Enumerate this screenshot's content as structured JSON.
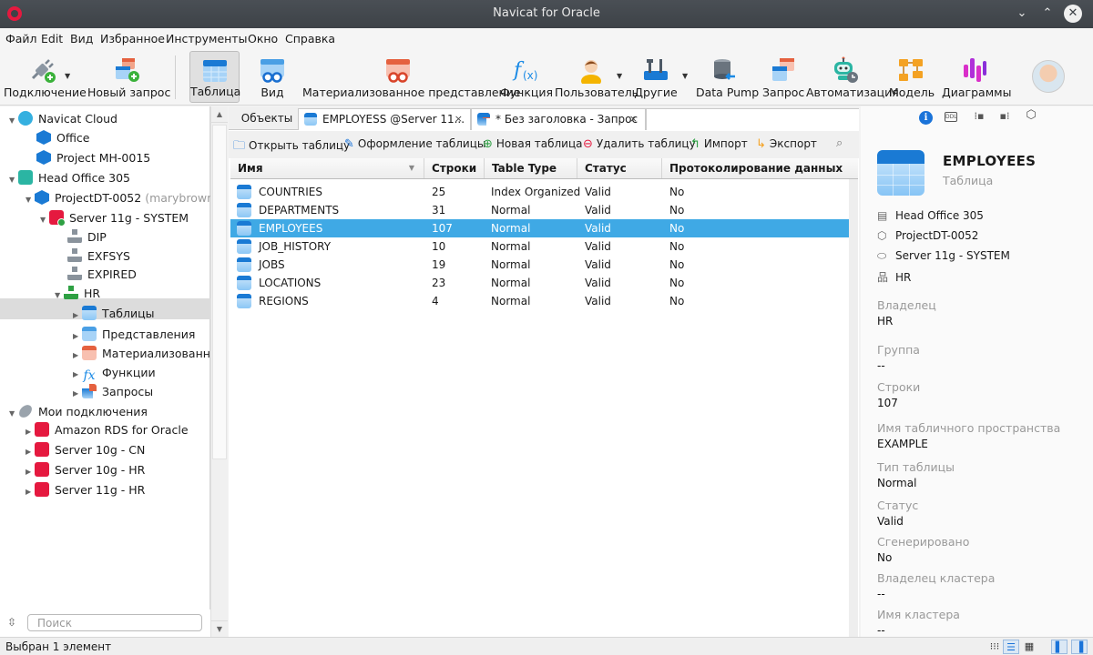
{
  "window": {
    "title": "Navicat for Oracle",
    "minimize": "⌄",
    "maximize": "⌃",
    "close": "✕"
  },
  "menu": [
    "Файл",
    "Edit",
    "Вид",
    "Избранное",
    "Инструменты",
    "Окно",
    "Справка"
  ],
  "toolbar": {
    "connection": "Подключение",
    "new_query": "Новый запрос",
    "table": "Таблица",
    "view": "Вид",
    "mat_view": "Материализованное представление",
    "function": "Функция",
    "user": "Пользователь",
    "other": "Другие",
    "data_pump": "Data Pump",
    "query": "Запрос",
    "automation": "Автоматизация",
    "model": "Модель",
    "charts": "Диаграммы"
  },
  "tree": {
    "navicat_cloud": "Navicat Cloud",
    "office": "Office",
    "project_mh": "Project MH-0015",
    "head_office": "Head Office 305",
    "project_dt": "ProjectDT-0052",
    "project_dt_user": "(marybrown@",
    "server_11g_system": "Server 11g - SYSTEM",
    "dip": "DIP",
    "exfsys": "EXFSYS",
    "expired": "EXPIRED",
    "hr": "HR",
    "tables": "Таблицы",
    "views": "Представления",
    "mat_views": "Материализованны",
    "functions": "Функции",
    "queries": "Запросы",
    "my_connections": "Мои подключения",
    "amazon_rds": "Amazon RDS for Oracle",
    "server_10g_cn": "Server 10g - CN",
    "server_10g_hr": "Server 10g - HR",
    "server_11g_hr": "Server 11g - HR"
  },
  "search": {
    "placeholder": "Поиск"
  },
  "status": {
    "text": "Выбран 1 элемент"
  },
  "tabs": {
    "objects": "Объекты",
    "tab1": "EMPLOYESS @Server 11...",
    "tab2": "* Без заголовка - Запрос",
    "close": "×"
  },
  "objbar": {
    "open": "Открыть таблицу",
    "design": "Оформление таблицы",
    "new": "Новая таблица",
    "delete": "Удалить таблицу",
    "import": "Импорт",
    "export": "Экспорт"
  },
  "grid": {
    "columns": [
      "Имя",
      "Строки",
      "Table Type",
      "Статус",
      "Протоколирование данных"
    ],
    "rows": [
      {
        "name": "COUNTRIES",
        "rows": "25",
        "type": "Index Organized",
        "status": "Valid",
        "logging": "No"
      },
      {
        "name": "DEPARTMENTS",
        "rows": "31",
        "type": "Normal",
        "status": "Valid",
        "logging": "No"
      },
      {
        "name": "EMPLOYEES",
        "rows": "107",
        "type": "Normal",
        "status": "Valid",
        "logging": "No"
      },
      {
        "name": "JOB_HISTORY",
        "rows": "10",
        "type": "Normal",
        "status": "Valid",
        "logging": "No"
      },
      {
        "name": "JOBS",
        "rows": "19",
        "type": "Normal",
        "status": "Valid",
        "logging": "No"
      },
      {
        "name": "LOCATIONS",
        "rows": "23",
        "type": "Normal",
        "status": "Valid",
        "logging": "No"
      },
      {
        "name": "REGIONS",
        "rows": "4",
        "type": "Normal",
        "status": "Valid",
        "logging": "No"
      }
    ],
    "selected_row": 2
  },
  "details": {
    "title": "EMPLOYEES",
    "subtitle": "Таблица",
    "path": [
      "Head Office 305",
      "ProjectDT-0052",
      "Server 11g - SYSTEM",
      "HR"
    ],
    "ddl": "DDL",
    "props": [
      {
        "label": "Владелец",
        "value": "HR"
      },
      {
        "label": "Группа",
        "value": "--"
      },
      {
        "label": "Строки",
        "value": "107"
      },
      {
        "label": "Имя табличного пространства",
        "value": "EXAMPLE"
      },
      {
        "label": "Тип таблицы",
        "value": "Normal"
      },
      {
        "label": "Статус",
        "value": "Valid"
      },
      {
        "label": "Сгенерировано",
        "value": "No"
      },
      {
        "label": "Владелец кластера",
        "value": "--"
      },
      {
        "label": "Имя кластера",
        "value": "--"
      }
    ]
  },
  "colors": {
    "accent": "#1a73d9",
    "selection": "#3fa9e5",
    "oracle_red": "#e5193f"
  }
}
